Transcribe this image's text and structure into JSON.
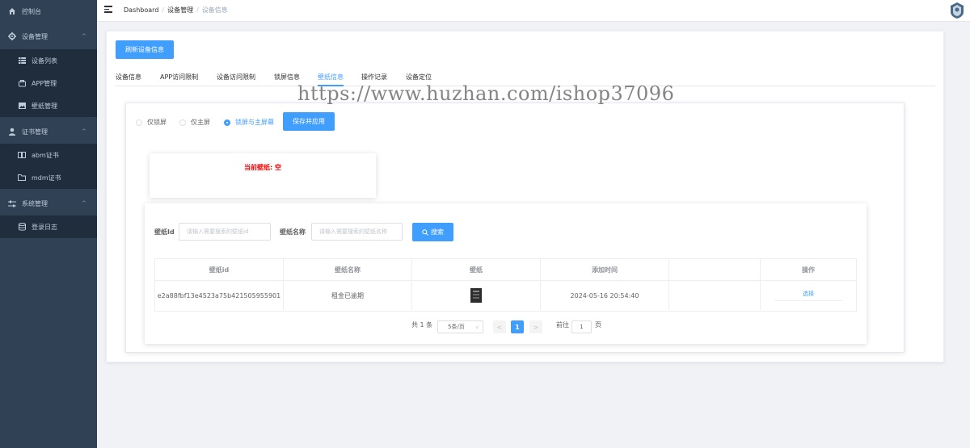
{
  "sidebar": {
    "items": [
      {
        "label": "控制台",
        "icon": "home-icon"
      },
      {
        "label": "设备管理",
        "icon": "gear-icon"
      },
      {
        "label": "设备列表",
        "icon": "grid-icon"
      },
      {
        "label": "APP管理",
        "icon": "app-icon"
      },
      {
        "label": "壁纸管理",
        "icon": "picture-icon"
      },
      {
        "label": "证书管理",
        "icon": "user-icon"
      },
      {
        "label": "abm证书",
        "icon": "book-icon"
      },
      {
        "label": "mdm证书",
        "icon": "folder-icon"
      },
      {
        "label": "系统管理",
        "icon": "sliders-icon"
      },
      {
        "label": "登录日志",
        "icon": "database-icon"
      }
    ]
  },
  "header": {
    "breadcrumb": [
      "Dashboard",
      "设备管理",
      "设备信息"
    ]
  },
  "main": {
    "refresh_button": "刷新设备信息",
    "tabs": [
      "设备信息",
      "APP访问限制",
      "设备访问限制",
      "锁屏信息",
      "壁纸信息",
      "操作记录",
      "设备定位"
    ],
    "active_tab": "壁纸信息",
    "radios": [
      "仅锁屏",
      "仅主屏",
      "锁屏与主屏幕"
    ],
    "selected_radio": "锁屏与主屏幕",
    "save_button": "保存并应用",
    "current_wallpaper": "当前壁纸: 空",
    "search": {
      "id_label": "壁纸Id",
      "id_placeholder": "请输入需要搜索的壁纸id",
      "name_label": "壁纸名称",
      "name_placeholder": "请输入需要搜索的壁纸名称",
      "button": "搜索"
    },
    "table": {
      "headers": [
        "壁纸id",
        "壁纸名称",
        "壁纸",
        "添加时间",
        "",
        "操作"
      ],
      "rows": [
        {
          "id": "e2a88fbf13e4523a75b421505955901",
          "name": "租金已逾期",
          "time": "2024-05-16 20:54:40",
          "extra": "",
          "action": "选择"
        }
      ]
    },
    "pagination": {
      "total": "共 1 条",
      "page_size": "5条/页",
      "prev": "<",
      "current": "1",
      "next": ">",
      "goto_prefix": "前往",
      "goto_value": "1",
      "goto_suffix": "页"
    }
  },
  "watermark": "https://www.huzhan.com/ishop37096",
  "colors": {
    "sidebar_bg": "#304156",
    "submenu_bg": "#1f2d3d",
    "primary": "#409eff",
    "danger": "#ff0000"
  }
}
